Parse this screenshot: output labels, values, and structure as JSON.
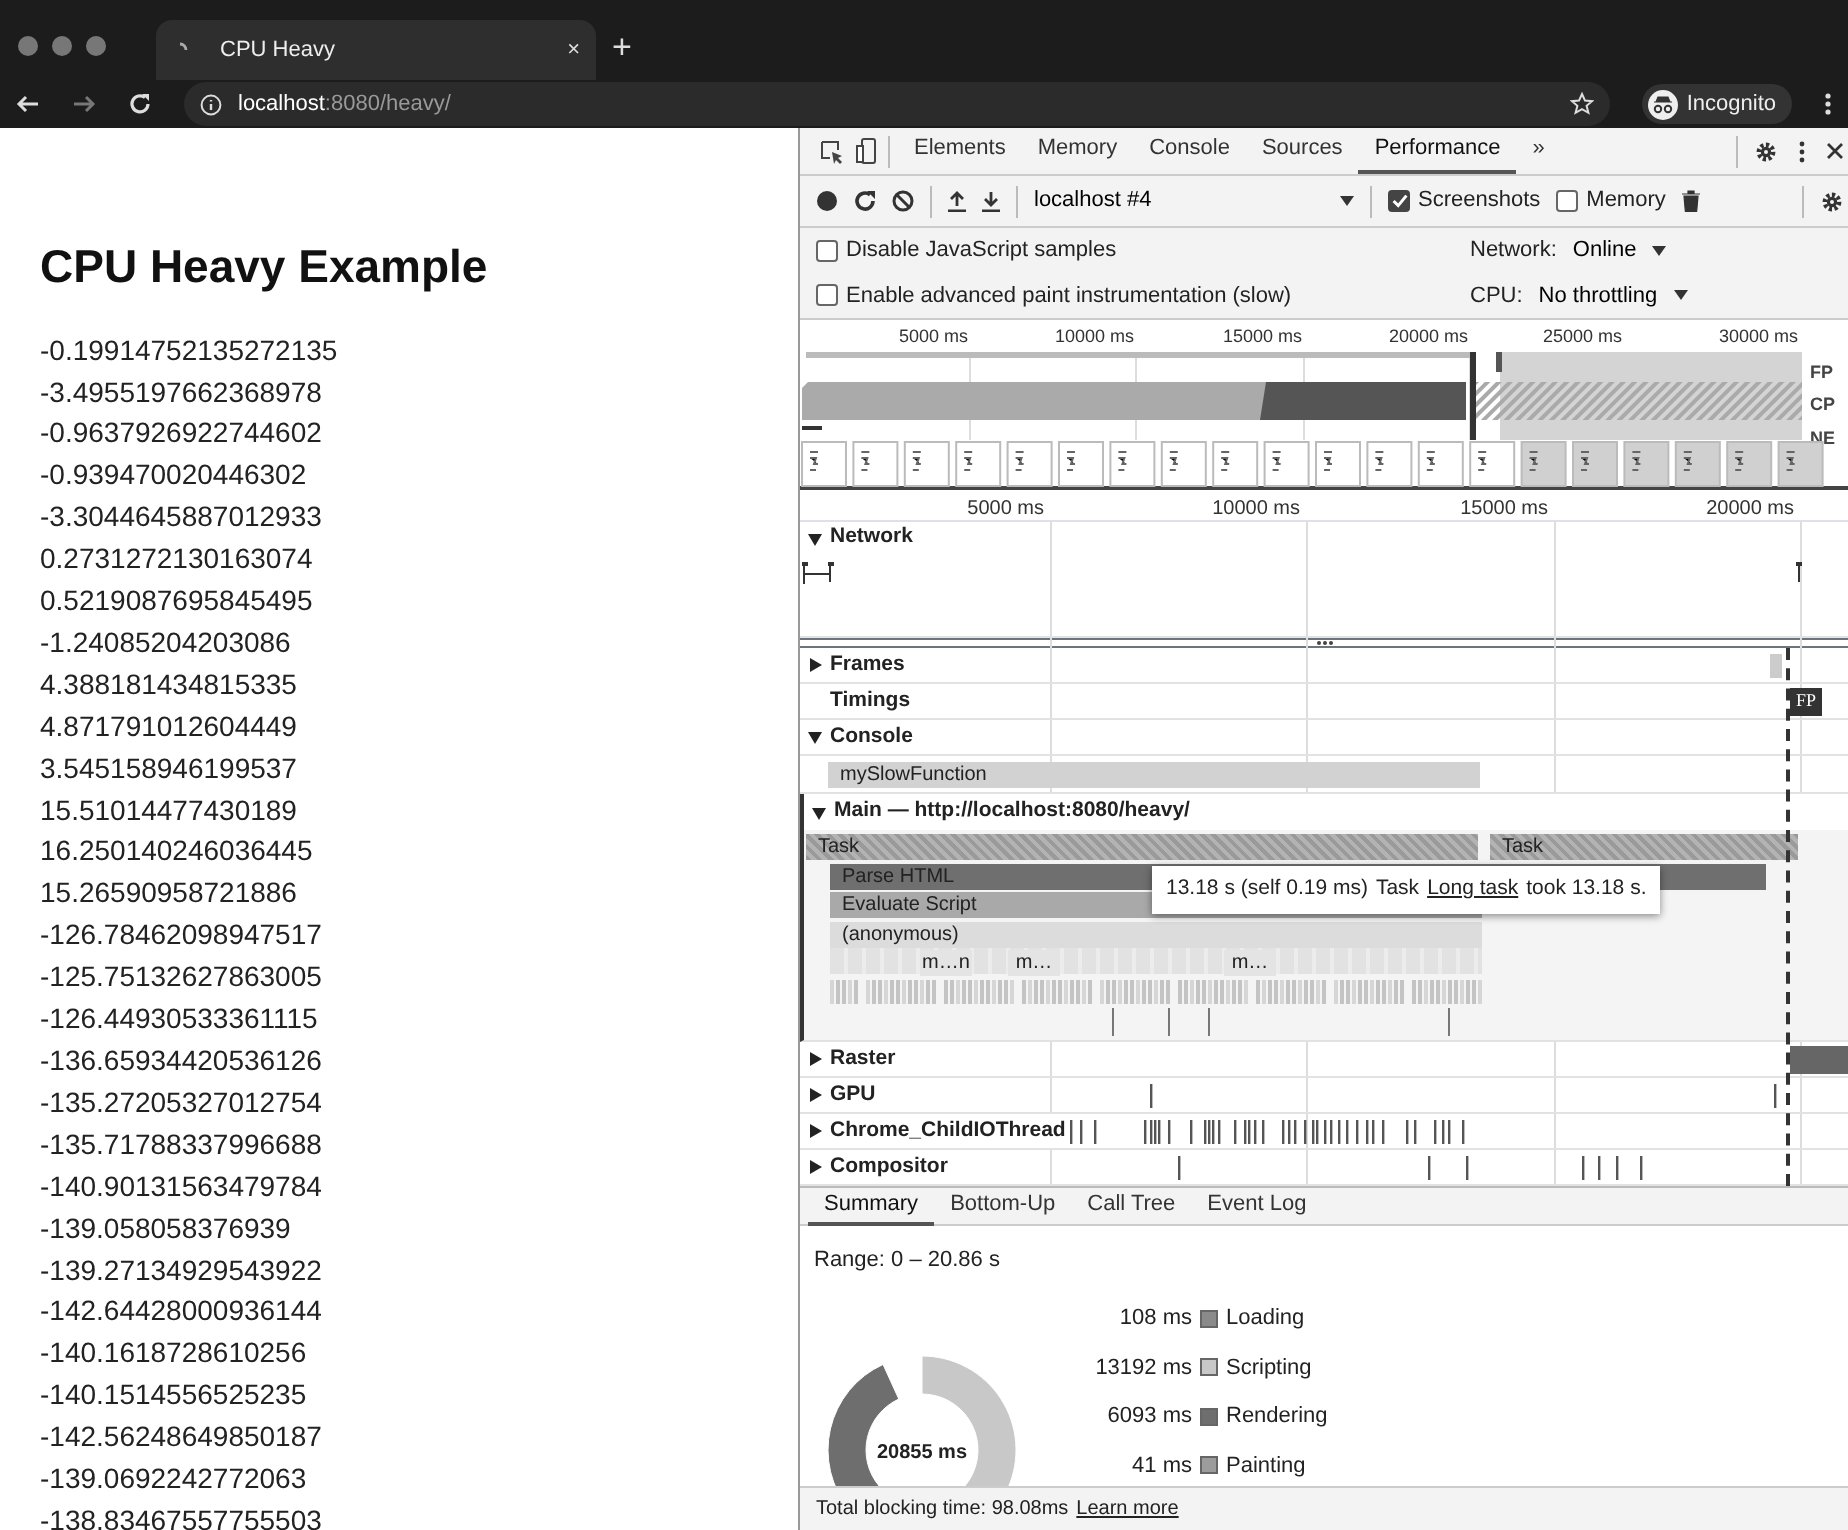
{
  "browser": {
    "tab": {
      "title": "CPU Heavy",
      "close": "×"
    },
    "new_tab": "+",
    "address": {
      "host": "localhost",
      "path": ":8080/heavy/"
    },
    "profile": "Incognito"
  },
  "page": {
    "heading": "CPU Heavy Example",
    "numbers": [
      "-0.19914752135272135",
      "-3.4955197662368978",
      "-0.9637926922744602",
      "-0.939470020446302",
      "-3.3044645887012933",
      "0.2731272130163074",
      "0.5219087695845495",
      "-1.24085204203086",
      "4.388181434815335",
      "4.871791012604449",
      "3.545158946199537",
      "15.51014477430189",
      "16.250140246036445",
      "15.26590958721886",
      "-126.78462098947517",
      "-125.75132627863005",
      "-126.44930533361115",
      "-136.65934420536126",
      "-135.27205327012754",
      "-135.71788337996688",
      "-140.90131563479784",
      "-139.058058376939",
      "-139.27134929543922",
      "-142.64428000936144",
      "-140.1618728610256",
      "-140.1514556525235",
      "-142.56248649850187",
      "-139.0692242772063",
      "-138.83467557755503"
    ]
  },
  "devtools": {
    "tabs": [
      {
        "label": "Elements",
        "selected": false
      },
      {
        "label": "Memory",
        "selected": false
      },
      {
        "label": "Console",
        "selected": false
      },
      {
        "label": "Sources",
        "selected": false
      },
      {
        "label": "Performance",
        "selected": true
      }
    ],
    "more": "»",
    "toolbar": {
      "profile": "localhost #4",
      "checks": [
        {
          "label": "Screenshots",
          "checked": true
        },
        {
          "label": "Memory",
          "checked": false
        }
      ]
    },
    "options": [
      {
        "label": "Disable JavaScript samples",
        "checked": false
      },
      {
        "label": "Enable advanced paint instrumentation (slow)",
        "checked": false
      }
    ],
    "throttles": [
      {
        "label": "Network:",
        "value": "Online"
      },
      {
        "label": "CPU:",
        "value": "No throttling"
      }
    ],
    "overview": {
      "ticks": [
        "5000 ms",
        "10000 ms",
        "15000 ms",
        "20000 ms",
        "25000 ms",
        "30000 ms"
      ],
      "lanes": [
        "FP",
        "CP",
        "NE"
      ]
    },
    "timeline": {
      "ticks": [
        "5000 ms",
        "10000 ms",
        "15000 ms",
        "20000 ms"
      ]
    },
    "network": {
      "label": "Network",
      "expanded": true
    },
    "tracks": [
      {
        "kind": "group",
        "label": "Frames",
        "expanded": false
      },
      {
        "kind": "static",
        "label": "Timings",
        "marker": "FP"
      },
      {
        "kind": "group",
        "label": "Console",
        "expanded": true,
        "entries": [
          "mySlowFunction"
        ]
      },
      {
        "kind": "main",
        "label": "Main — http://localhost:8080/heavy/",
        "expanded": true
      },
      {
        "kind": "group",
        "label": "Raster",
        "expanded": false
      },
      {
        "kind": "group",
        "label": "GPU",
        "expanded": false
      },
      {
        "kind": "group",
        "label": "Chrome_ChildIOThread",
        "expanded": false
      },
      {
        "kind": "group",
        "label": "Compositor",
        "expanded": false
      }
    ],
    "flame": [
      {
        "label": "Task"
      },
      {
        "label": "Task"
      },
      {
        "label": "Parse HTML"
      },
      {
        "label": "Evaluate Script"
      },
      {
        "label": "(anonymous)"
      },
      {
        "label": "m…n"
      },
      {
        "label": "m…"
      },
      {
        "label": "m…"
      }
    ],
    "tooltip": {
      "duration": "13.18 s (self 0.19 ms)",
      "name": "Task",
      "link": "Long task",
      "rest": "took 13.18 s."
    },
    "bottom_tabs": [
      {
        "label": "Summary",
        "selected": true
      },
      {
        "label": "Bottom-Up",
        "selected": false
      },
      {
        "label": "Call Tree",
        "selected": false
      },
      {
        "label": "Event Log",
        "selected": false
      }
    ],
    "summary": {
      "range": "Range: 0 – 20.86 s",
      "total": "20855 ms",
      "legend": [
        {
          "value": "108 ms",
          "label": "Loading",
          "color": "#8a8a8a"
        },
        {
          "value": "13192 ms",
          "label": "Scripting",
          "color": "#c8c8c8"
        },
        {
          "value": "6093 ms",
          "label": "Rendering",
          "color": "#6e6e6e"
        },
        {
          "value": "41 ms",
          "label": "Painting",
          "color": "#9c9c9c"
        }
      ]
    },
    "footer": {
      "text": "Total blocking time: 98.08ms",
      "link": "Learn more"
    }
  }
}
